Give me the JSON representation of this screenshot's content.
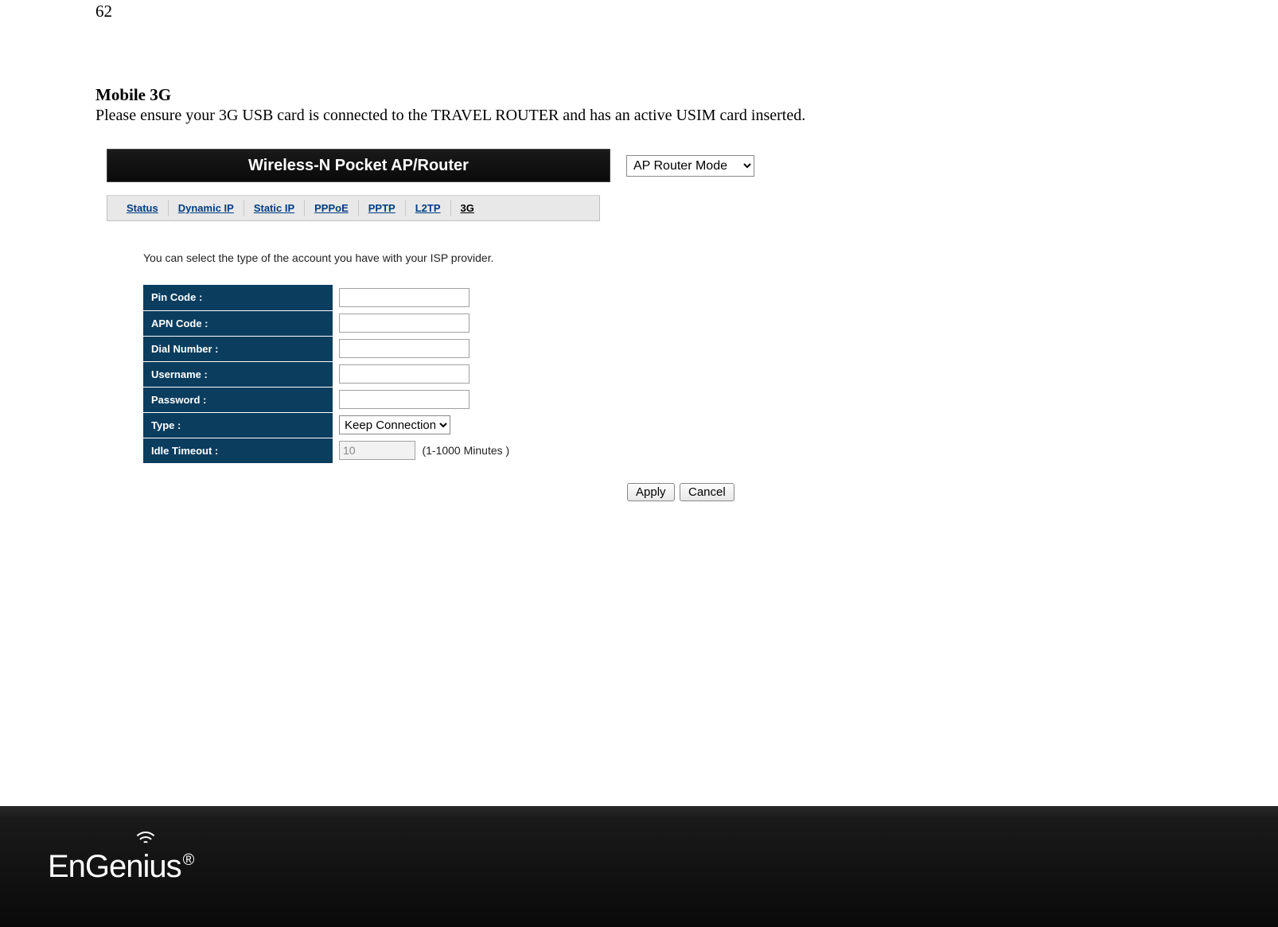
{
  "page_number": "62",
  "section": {
    "title": "Mobile 3G",
    "description": "Please ensure your 3G USB card is connected to the TRAVEL ROUTER and has an active USIM card inserted."
  },
  "router": {
    "banner_title": "Wireless-N Pocket AP/Router",
    "mode": "AP Router Mode",
    "tabs": [
      "Status",
      "Dynamic IP",
      "Static IP",
      "PPPoE",
      "PPTP",
      "L2TP",
      "3G"
    ],
    "active_tab": "3G",
    "instruction": "You can select the type of the account you have with your ISP provider.",
    "fields": {
      "pin_code": {
        "label": "Pin Code :",
        "value": ""
      },
      "apn_code": {
        "label": "APN Code :",
        "value": ""
      },
      "dial_number": {
        "label": "Dial Number :",
        "value": ""
      },
      "username": {
        "label": "Username :",
        "value": ""
      },
      "password": {
        "label": "Password :",
        "value": ""
      },
      "type": {
        "label": "Type :",
        "value": "Keep Connection"
      },
      "idle_timeout": {
        "label": "Idle Timeout :",
        "value": "10",
        "hint": "(1-1000 Minutes )"
      }
    },
    "buttons": {
      "apply": "Apply",
      "cancel": "Cancel"
    }
  },
  "footer": {
    "brand": "EnGenius",
    "reg": "®"
  }
}
